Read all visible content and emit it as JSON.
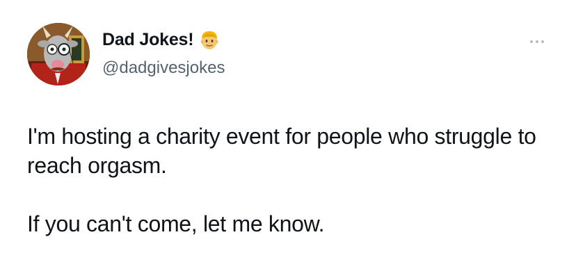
{
  "author": {
    "display_name": "Dad Jokes!",
    "handle": "@dadgivesjokes",
    "badge_icon": "blond-man-emoji-icon",
    "avatar_icon": "goat-with-monocle-avatar"
  },
  "menu": {
    "icon": "more-options-icon"
  },
  "tweet": {
    "paragraphs": [
      "I'm hosting a charity event for people who struggle to reach orgasm.",
      "If you can't come, let me know."
    ]
  },
  "colors": {
    "text": "#0f1419",
    "secondary_text": "#536471",
    "background": "#ffffff"
  }
}
